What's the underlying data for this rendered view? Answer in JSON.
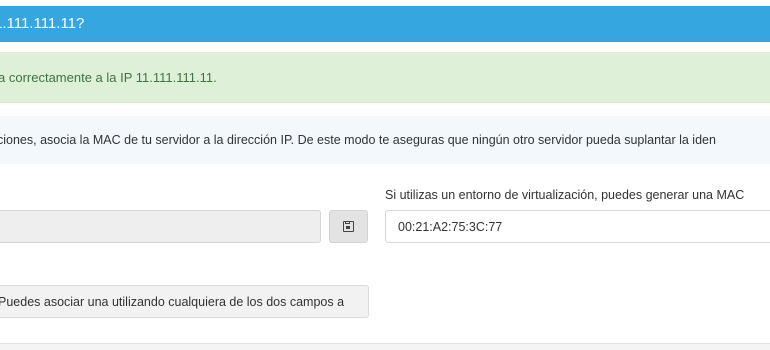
{
  "header": {
    "title": "1.111.111.11?"
  },
  "success_alert": {
    "text": "a correctamente a la IP 11.111.111.11."
  },
  "info_alert": {
    "text": "ciones, asocia la MAC de tu servidor a la dirección IP. De este modo te aseguras que ningún otro servidor pueda suplantar la iden"
  },
  "form": {
    "left_input_value": "",
    "save_icon": "floppy-disk-icon",
    "virtualization_label": "Si utilizas un entorno de virtualización, puedes generar una MAC",
    "mac_value": "00:21:A2:75:3C:77"
  },
  "help": {
    "text": "Puedes asociar una utilizando cualquiera de los dos campos a"
  },
  "colors": {
    "header_bg": "#35a6e0",
    "success_bg": "#dff0d8",
    "success_text": "#3c763d",
    "info_bg": "#f3f8fd"
  }
}
